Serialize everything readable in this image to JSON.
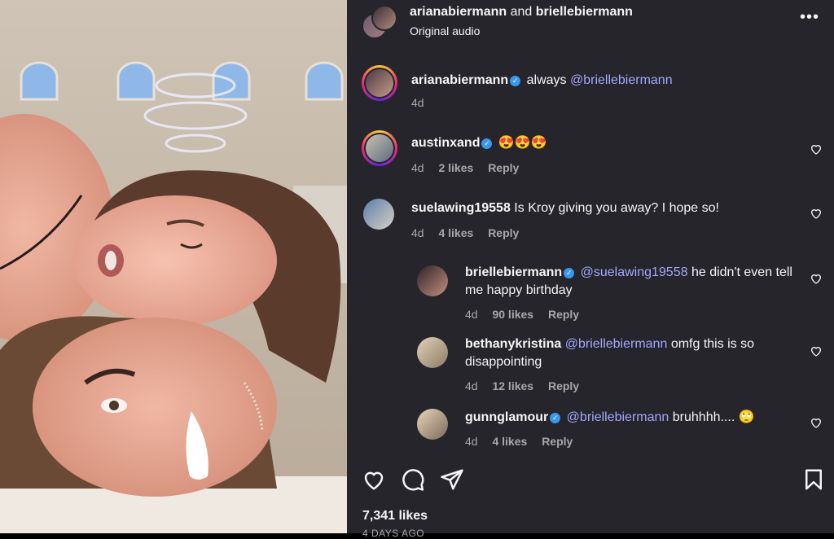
{
  "header": {
    "user1": "arianabiermann",
    "and_text": "and",
    "user2": "briellebiermann",
    "subtitle": "Original audio",
    "more_icon": "more-horizontal-icon"
  },
  "caption": {
    "username": "arianabiermann",
    "verified": true,
    "text_prefix": "always",
    "mention": "@briellebiermann",
    "time": "4d"
  },
  "comments": [
    {
      "username": "austinxand",
      "verified": true,
      "text": "😍😍😍",
      "time": "4d",
      "likes": "2 likes",
      "reply": "Reply"
    },
    {
      "username": "suelawing19558",
      "verified": false,
      "text": "Is Kroy giving you away? I hope so!",
      "time": "4d",
      "likes": "4 likes",
      "reply": "Reply"
    },
    {
      "username": "briellebiermann",
      "verified": true,
      "mention": "@suelawing19558",
      "text": "he didn't even tell me happy birthday",
      "time": "4d",
      "likes": "90 likes",
      "reply": "Reply"
    },
    {
      "username": "bethanykristina",
      "verified": false,
      "mention": "@briellebiermann",
      "text": "omfg this is so disappointing",
      "time": "4d",
      "likes": "12 likes",
      "reply": "Reply"
    },
    {
      "username": "gunnglamour",
      "verified": true,
      "mention": "@briellebiermann",
      "text": "bruhhhh.... 🙄",
      "time": "4d",
      "likes": "4 likes",
      "reply": "Reply"
    }
  ],
  "footer": {
    "likes": "7,341 likes",
    "posted": "4 DAYS AGO"
  },
  "icons": [
    "heart-icon",
    "comment-icon",
    "share-icon",
    "save-icon"
  ]
}
